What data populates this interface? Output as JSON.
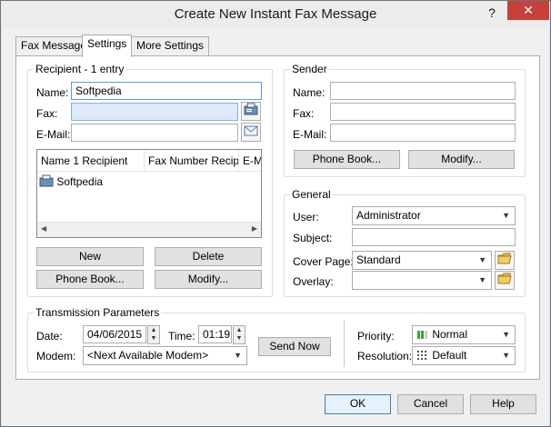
{
  "window": {
    "title": "Create New Instant Fax Message",
    "help_glyph": "?",
    "close_glyph": "✕"
  },
  "tabs": [
    {
      "label": "Fax Message"
    },
    {
      "label": "Settings"
    },
    {
      "label": "More Settings"
    }
  ],
  "recipient": {
    "group_title": "Recipient - 1 entry",
    "name_label": "Name:",
    "name_value": "Softpedia",
    "fax_label": "Fax:",
    "fax_value": "",
    "email_label": "E-Mail:",
    "email_value": "",
    "list": {
      "columns": [
        "Name 1 Recipient",
        "Fax Number Recipien",
        "E-Ma"
      ],
      "rows": [
        {
          "name": "Softpedia"
        }
      ]
    },
    "new_label": "New",
    "delete_label": "Delete",
    "phonebook_label": "Phone Book...",
    "modify_label": "Modify..."
  },
  "sender": {
    "group_title": "Sender",
    "name_label": "Name:",
    "fax_label": "Fax:",
    "email_label": "E-Mail:",
    "phonebook_label": "Phone Book...",
    "modify_label": "Modify..."
  },
  "general": {
    "group_title": "General",
    "user_label": "User:",
    "user_value": "Administrator",
    "subject_label": "Subject:",
    "subject_value": "",
    "coverpage_label": "Cover Page:",
    "coverpage_value": "Standard",
    "overlay_label": "Overlay:",
    "overlay_value": ""
  },
  "transmission": {
    "group_title": "Transmission Parameters",
    "date_label": "Date:",
    "date_value": "04/06/2015",
    "time_label": "Time:",
    "time_value": "01:19",
    "modem_label": "Modem:",
    "modem_value": "<Next Available Modem>",
    "send_now_label": "Send Now",
    "priority_label": "Priority:",
    "priority_value": "Normal",
    "resolution_label": "Resolution:",
    "resolution_value": "Default"
  },
  "footer": {
    "ok_label": "OK",
    "cancel_label": "Cancel",
    "help_label": "Help"
  },
  "colors": {
    "close_button": "#c7403a",
    "focus_border": "#569de5",
    "fax_field_bg": "#dce9f8"
  }
}
